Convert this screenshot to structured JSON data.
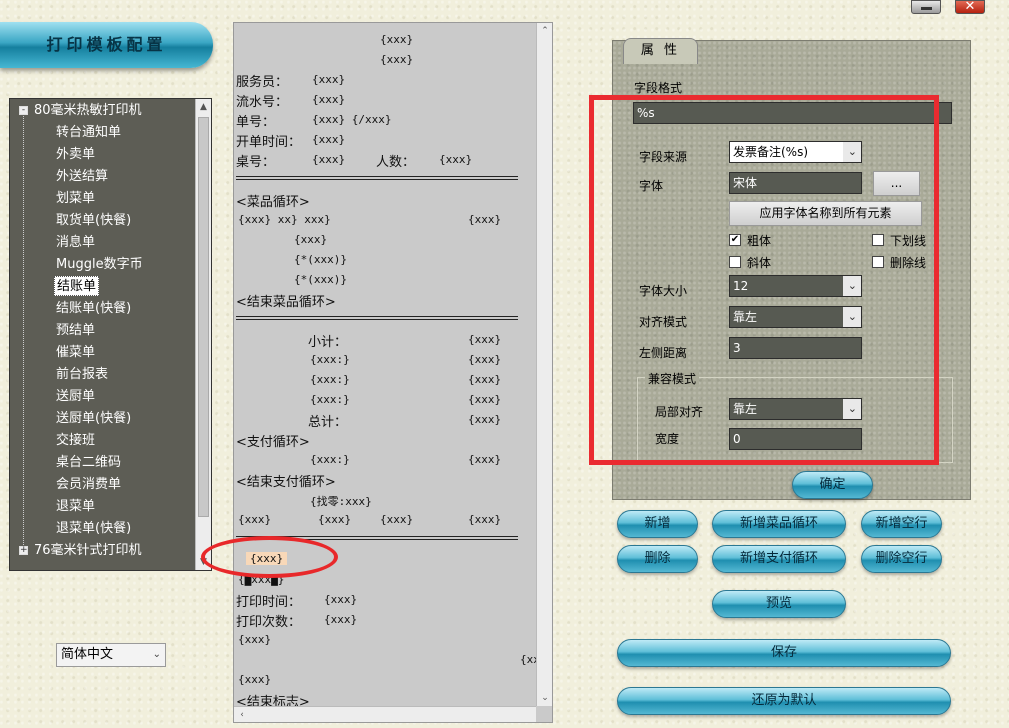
{
  "window": {
    "close_glyph": "✕"
  },
  "title": "打印模板配置",
  "tree": {
    "groups": [
      {
        "label": "80毫米热敏打印机",
        "expander": "-"
      },
      {
        "label": "76毫米针式打印机",
        "expander": "+"
      }
    ],
    "items": [
      "转台通知单",
      "外卖单",
      "外送结算",
      "划菜单",
      "取货单(快餐)",
      "消息单",
      "Muggle数字币",
      "结账单",
      "结账单(快餐)",
      "预结单",
      "催菜单",
      "前台报表",
      "送厨单",
      "送厨单(快餐)",
      "交接班",
      "桌台二维码",
      "会员消费单",
      "退菜单",
      "退菜单(快餐)"
    ],
    "selected": "结账单"
  },
  "language": {
    "value": "简体中文"
  },
  "preview": {
    "lines": {
      "l1": "{xxx}",
      "l2": "{xxx}",
      "waiter_label": "服务员：",
      "waiter_val": "{xxx}",
      "serial_label": "流水号：",
      "serial_val": "{xxx}",
      "order_label": "单号：",
      "order_val": "{xxx} {/xxx}",
      "open_label": "开单时间：",
      "open_val": "{xxx}",
      "table_label": "桌号：",
      "table_val": "{xxx}",
      "people_label": "人数：",
      "people_val": "{xxx}",
      "dish_loop": "<菜品循环>",
      "dish1": "{xxx} xx} xxx}",
      "dish1_right": "{xxx}",
      "dish2": "{xxx}",
      "dish3": "{*(xxx)}",
      "dish4": "{*(xxx)}",
      "dish_end": "<结束菜品循环>",
      "subtotal_label": "小计：",
      "subtotal_val": "{xxx}",
      "r1": "{xxx:}",
      "r1v": "{xxx}",
      "r2": "{xxx:}",
      "r2v": "{xxx}",
      "r3": "{xxx:}",
      "r3v": "{xxx}",
      "total_label": "总计：",
      "total_val": "{xxx}",
      "pay_loop": "<支付循环>",
      "p1": "{xxx:}",
      "p1v": "{xxx}",
      "pay_end": "<结束支付循环>",
      "change": "{找零:xxx}",
      "c1": "{xxx}",
      "c2": "{xxx}",
      "c3": "{xxx}",
      "c4": "{xxx}",
      "highlight": "{xxx}",
      "partial": "{▇xxx▇}",
      "print_time_label": "打印时间：",
      "print_time_val": "{xxx}",
      "print_count_label": "打印次数：",
      "print_count_val": "{xxx}",
      "z1": "{xxx}",
      "z2": "{xx",
      "z3": "{xxx}",
      "end_tag": "<结束标志>"
    }
  },
  "props": {
    "tab": "属 性",
    "field_format_label": "字段格式",
    "field_format_value": "%s",
    "source_label": "字段来源",
    "source_value": "发票备注(%s)",
    "font_label": "字体",
    "font_value": "宋体",
    "font_browse": "...",
    "apply_font_button": "应用字体名称到所有元素",
    "bold_label": "粗体",
    "bold_checked": true,
    "underline_label": "下划线",
    "underline_checked": false,
    "italic_label": "斜体",
    "italic_checked": false,
    "strike_label": "删除线",
    "strike_checked": false,
    "size_label": "字体大小",
    "size_value": "12",
    "align_label": "对齐模式",
    "align_value": "靠左",
    "left_margin_label": "左侧距离",
    "left_margin_value": "3",
    "compat_group": "兼容模式",
    "local_align_label": "局部对齐",
    "local_align_value": "靠左",
    "width_label": "宽度",
    "width_value": "0",
    "caret": "⌄"
  },
  "buttons": {
    "confirm": "确定",
    "add": "新增",
    "add_dish_loop": "新增菜品循环",
    "add_blank": "新增空行",
    "delete": "删除",
    "add_pay_loop": "新增支付循环",
    "delete_blank": "删除空行",
    "preview": "预览",
    "save": "保存",
    "restore": "还原为默认"
  },
  "colors": {
    "annotation_red": "#e8282a",
    "pill_blue": "#1f8fb0"
  }
}
